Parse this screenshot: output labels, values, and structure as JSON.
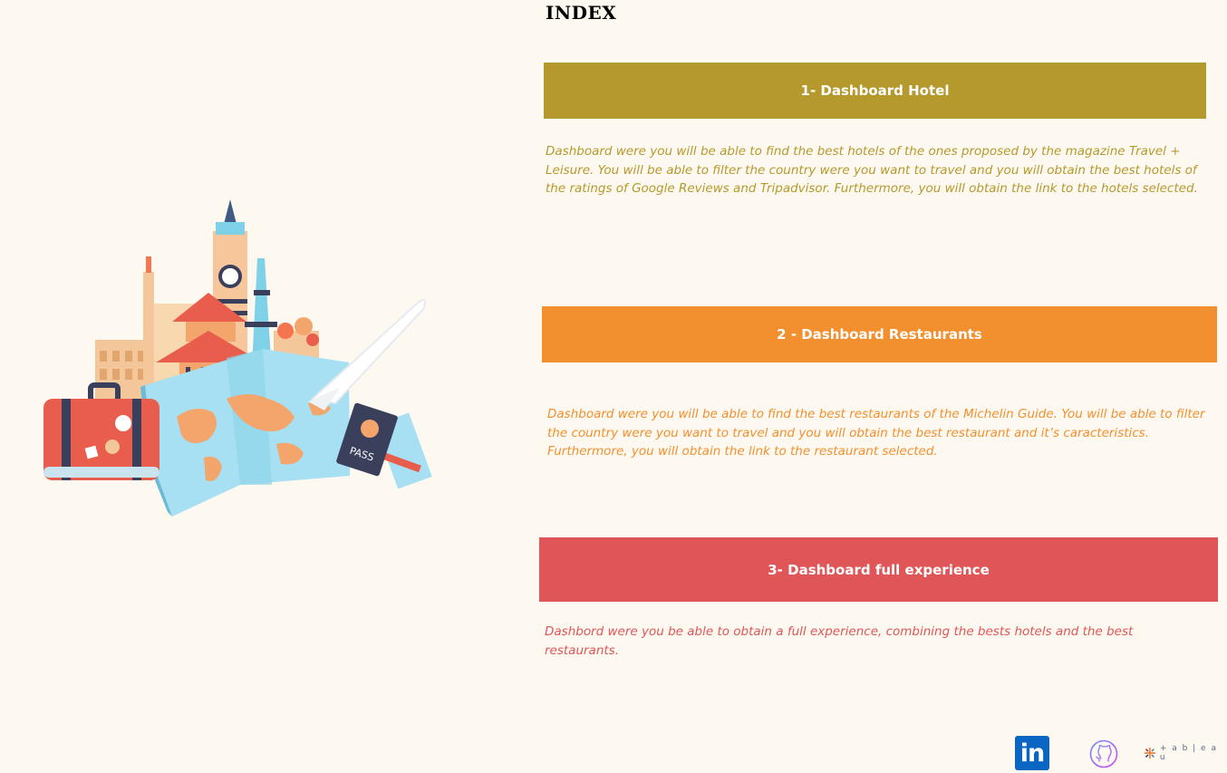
{
  "index": {
    "title": "INDEX"
  },
  "dashboards": [
    {
      "label": "1- Dashboard Hotel",
      "description": "Dashboard were you will be able to find the best hotels of the ones proposed by the magazine Travel + Leisure. You will be able to filter the country were you want to travel and you will obtain the best hotels of the ratings of Google Reviews and Tripadvisor. Furthermore, you will obtain the link to the hotels selected.",
      "color": "#b5992d"
    },
    {
      "label": "2 - Dashboard Restaurants",
      "description": "Dashboard were you will be able to find the best restaurants of the Michelin Guide.  You will be able to filter the country were you want to travel and you will obtain the best restaurant and it’s caracteristics. Furthermore, you will obtain the link to the restaurant selected.",
      "color": "#f28f2f"
    },
    {
      "label": "3- Dashboard full experience",
      "description": "Dashbord were you be able to obtain a full experience, combining the bests hotels and the best restaurants.",
      "color": "#e05557"
    }
  ],
  "illustration": {
    "passport_text": "PASS"
  },
  "footer": {
    "linkedin_text": "in",
    "tableau_text": "+ a b | e a u",
    "icons": [
      "linkedin-icon",
      "github-icon",
      "tableau-icon"
    ]
  }
}
